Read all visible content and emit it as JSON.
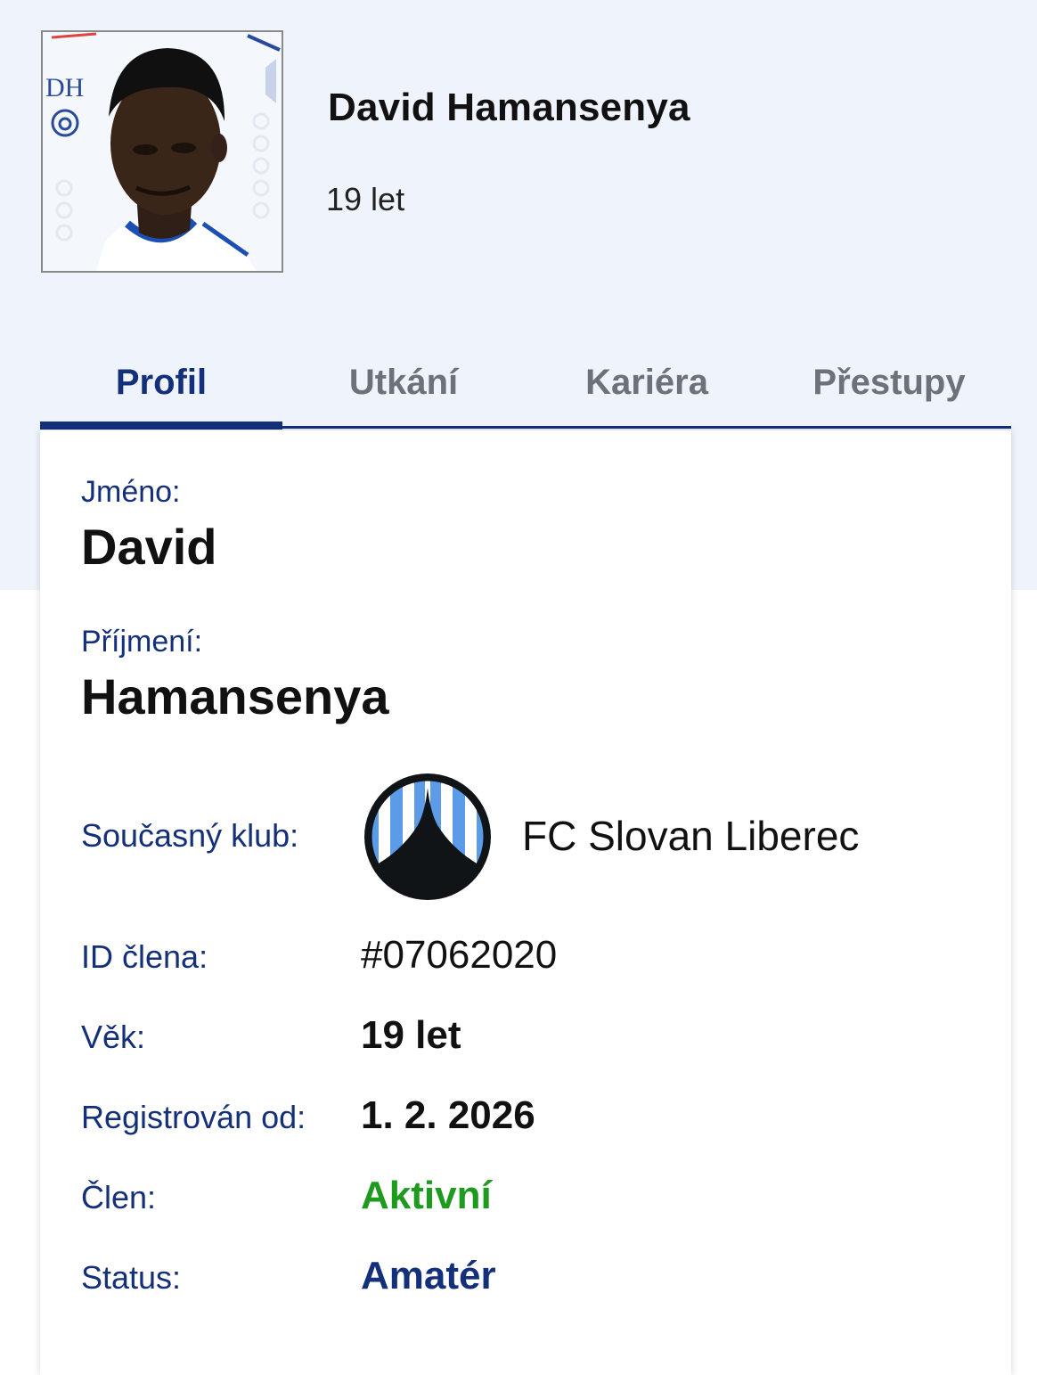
{
  "header": {
    "player_name": "David Hamansenya",
    "age": "19 let",
    "photo_initials": "DH"
  },
  "tabs": [
    {
      "label": "Profil",
      "active": true
    },
    {
      "label": "Utkání",
      "active": false
    },
    {
      "label": "Kariéra",
      "active": false
    },
    {
      "label": "Přestupy",
      "active": false
    }
  ],
  "profile": {
    "first_name_label": "Jméno:",
    "first_name": "David",
    "last_name_label": "Příjmení:",
    "last_name": "Hamansenya",
    "club_label": "Současný klub:",
    "club_name": "FC Slovan Liberec",
    "member_id_label": "ID člena:",
    "member_id": "#07062020",
    "age_label": "Věk:",
    "age": "19 let",
    "registered_label": "Registrován od:",
    "registered": "1. 2. 2026",
    "member_label": "Člen:",
    "member_status": "Aktivní",
    "status_label": "Status:",
    "status": "Amatér"
  },
  "colors": {
    "accent": "#14307a",
    "active_green": "#1e9a1e",
    "header_bg": "#eff3fb",
    "club_blue": "#5b9be8"
  },
  "icons": {
    "club_logo": "fc-slovan-liberec-crest"
  }
}
